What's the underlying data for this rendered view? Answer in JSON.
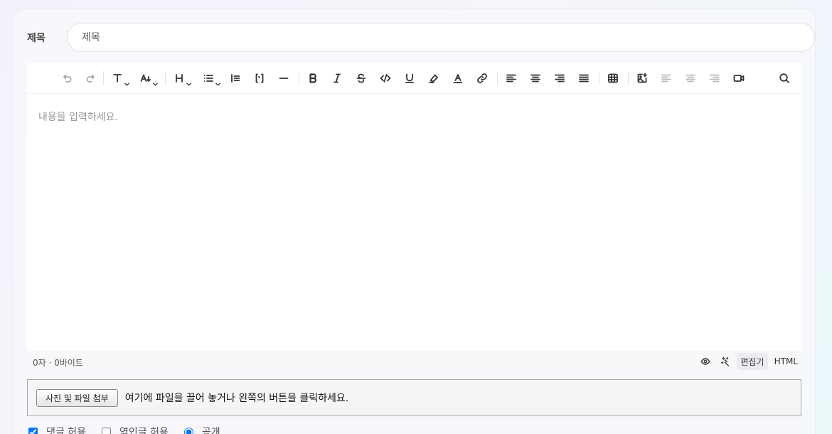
{
  "title": {
    "label": "제목",
    "placeholder": "제목"
  },
  "toolbar": {
    "items": [
      "undo-icon",
      "redo-icon",
      "font-icon",
      "font-size-icon",
      "heading-icon",
      "list-icon",
      "blockquote-icon",
      "code-block-icon",
      "horizontal-rule-icon",
      "bold-icon",
      "italic-icon",
      "strike-icon",
      "code-icon",
      "underline-icon",
      "highlight-icon",
      "text-color-icon",
      "link-icon",
      "align-left-icon",
      "align-center-icon",
      "align-right-icon",
      "align-justify-icon",
      "table-icon",
      "image-icon",
      "image-align-left-icon",
      "image-align-center-icon",
      "image-align-right-icon",
      "video-icon",
      "search-icon"
    ]
  },
  "content": {
    "placeholder": "내용을 입력하세요."
  },
  "status": {
    "count": "0자 · 0바이트",
    "modes": {
      "editor": "편집기",
      "html": "HTML"
    }
  },
  "upload": {
    "button": "사진 및 파일 첨부",
    "hint": "여기에 파일을 끌어 놓거나 왼쪽의 버튼을 클릭하세요."
  },
  "options": {
    "allow_comments": "댓글 허용",
    "allow_trackback": "엮인글 허용",
    "public": "공개"
  }
}
